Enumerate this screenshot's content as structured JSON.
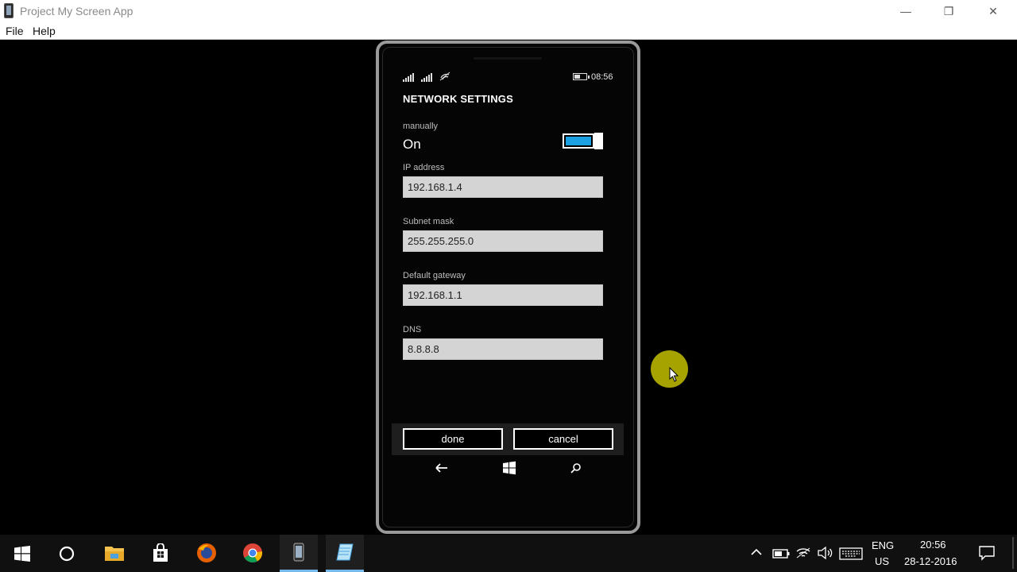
{
  "window": {
    "title": "Project My Screen App",
    "minimize": "—",
    "maximize": "❐",
    "close": "✕"
  },
  "menu": [
    "File",
    "Help"
  ],
  "phone": {
    "status": {
      "time": "08:56"
    },
    "title": "NETWORK SETTINGS",
    "manual": {
      "label": "manually",
      "state": "On",
      "toggle_on": true,
      "accent": "#1ba1e2"
    },
    "fields": [
      {
        "label": "IP address",
        "value": "192.168.1.4"
      },
      {
        "label": "Subnet mask",
        "value": "255.255.255.0"
      },
      {
        "label": "Default gateway",
        "value": "192.168.1.1"
      },
      {
        "label": "DNS",
        "value": "8.8.8.8"
      }
    ],
    "buttons": {
      "done": "done",
      "cancel": "cancel"
    },
    "nav": {
      "back": "back-arrow-icon",
      "start": "windows-logo-icon",
      "search": "search-icon"
    }
  },
  "taskbar": {
    "apps": [
      "windows-start-icon",
      "cortana-icon",
      "file-explorer-icon",
      "store-icon",
      "firefox-icon",
      "chrome-icon",
      "phone-app-icon",
      "notepad-icon"
    ],
    "language": {
      "top": "ENG",
      "bottom": "US"
    },
    "clock": {
      "time": "20:56",
      "date": "28-12-2016"
    }
  }
}
